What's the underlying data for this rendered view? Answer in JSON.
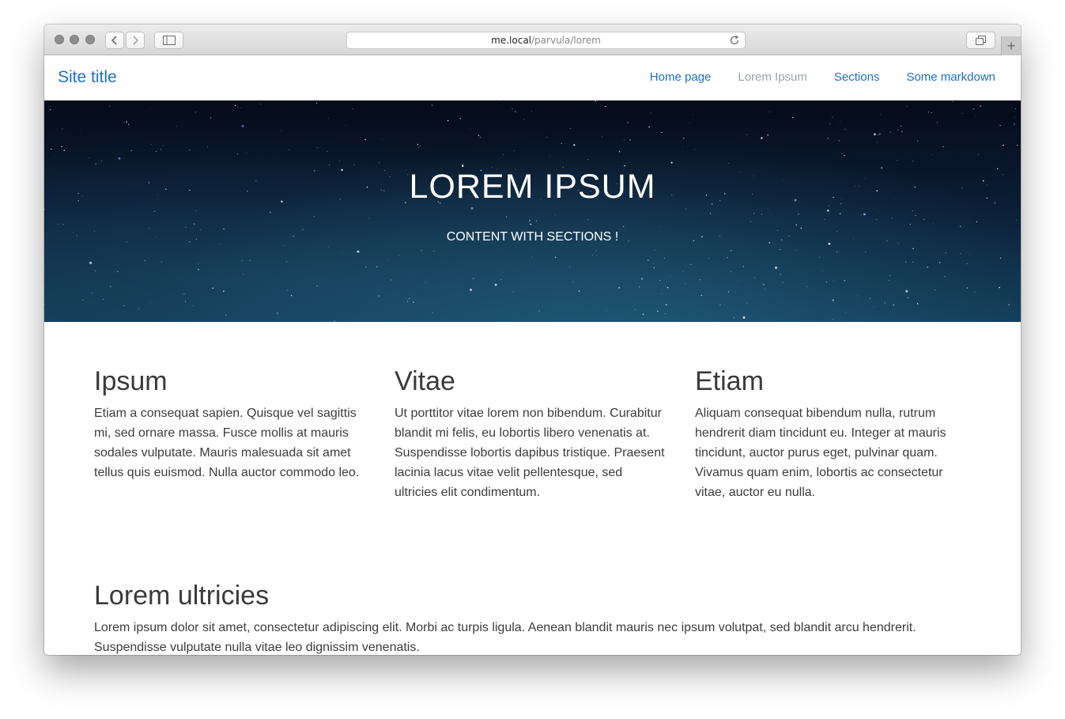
{
  "browser": {
    "url_host": "me.local",
    "url_path": "/parvula/lorem",
    "new_tab_label": "+"
  },
  "nav": {
    "site_title": "Site title",
    "links": [
      "Home page",
      "Lorem Ipsum",
      "Sections",
      "Some markdown"
    ],
    "active_index": 1
  },
  "hero": {
    "title": "LOREM IPSUM",
    "subtitle": "CONTENT WITH SECTIONS !"
  },
  "sections": [
    {
      "heading": "Ipsum",
      "body": "Etiam a consequat sapien. Quisque vel sagittis mi, sed ornare massa. Fusce mollis at mauris sodales vulputate. Mauris malesuada sit amet tellus quis euismod. Nulla auctor commodo leo."
    },
    {
      "heading": "Vitae",
      "body": "Ut porttitor vitae lorem non bibendum. Curabitur blandit mi felis, eu lobortis libero venenatis at. Suspendisse lobortis dapibus tristique. Praesent lacinia lacus vitae velit pellentesque, sed ultricies elit condimentum."
    },
    {
      "heading": "Etiam",
      "body": "Aliquam consequat bibendum nulla, rutrum hendrerit diam tincidunt eu. Integer at mauris tincidunt, auctor purus eget, pulvinar quam. Vivamus quam enim, lobortis ac consectetur vitae, auctor eu nulla."
    }
  ],
  "full_section": {
    "heading": "Lorem ultricies",
    "body": "Lorem ipsum dolor sit amet, consectetur adipiscing elit. Morbi ac turpis ligula. Aenean blandit mauris nec ipsum volutpat, sed blandit arcu hendrerit. Suspendisse vulputate nulla vitae leo dignissim venenatis."
  },
  "colors": {
    "link": "#1e6fc8",
    "active_link": "#9aa4ad",
    "text": "#3d3d3d"
  }
}
